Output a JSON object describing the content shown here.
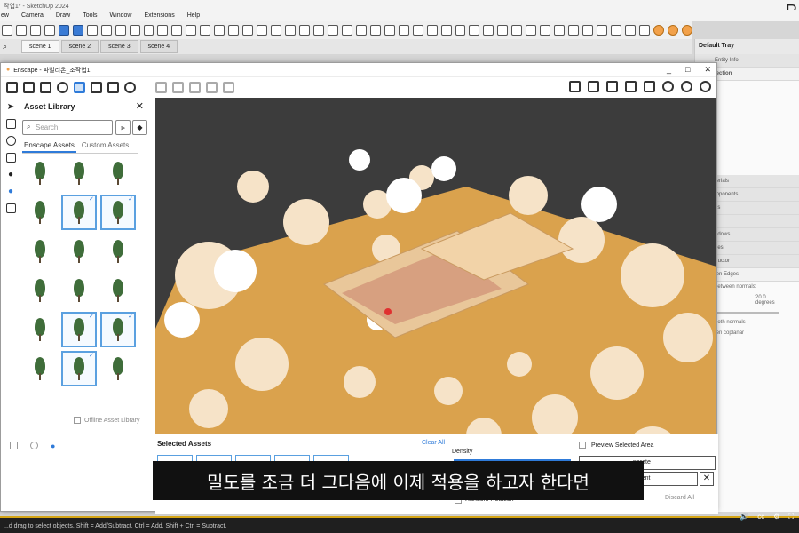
{
  "sketchup": {
    "title": "작업1* - SketchUp 2024",
    "menu": [
      "ew",
      "Camera",
      "Draw",
      "Tools",
      "Window",
      "Extensions",
      "Help"
    ],
    "logo_letter": "R",
    "scene_tabs": [
      "scene 1",
      "scene 2",
      "scene 3",
      "scene 4"
    ],
    "active_scene": 0
  },
  "tray": {
    "title": "Default Tray",
    "entity_info": "Entity Info",
    "selection": "lection",
    "sections": [
      "terials",
      "mponents",
      "es",
      "s",
      "ndows",
      "nes",
      "tructor",
      "ten Edges"
    ],
    "between_normals": "between normals:",
    "angle_value": "20.0",
    "angle_unit": "degrees",
    "smooth": "ooth normals",
    "coplanar": "ten coplanar"
  },
  "enscape": {
    "title": "Enscape - 파빌리온_조작법1",
    "win_min": "_",
    "win_max": "□",
    "win_close": "✕",
    "asset_library": {
      "title": "Asset Library",
      "close": "✕",
      "search_placeholder": "Search",
      "tabs": [
        "Enscape Assets",
        "Custom Assets"
      ],
      "offline": "Offline Asset Library"
    },
    "selected": {
      "title": "Selected Assets",
      "clear_all": "Clear All",
      "density": "Density",
      "preview": "Preview Selected Area",
      "generate": "nerate",
      "placement": "ement",
      "close": "✕",
      "discard": "Discard All",
      "random_rotation": "Random Rotation"
    }
  },
  "subtitle": "밀도를 조금 더 그다음에 이제 적용을 하고자 한다면",
  "status": "...d drag to select objects. Shift = Add/Subtract. Ctrl = Add. Shift + Ctrl = Subtract.",
  "video": {
    "progress": 1.0,
    "icons": [
      "🔊",
      "cc",
      "⚙",
      "⛶"
    ]
  },
  "colors": {
    "accent": "#2f7bd9",
    "ground": "#e3a84e",
    "sky": "#3c3c3c"
  }
}
